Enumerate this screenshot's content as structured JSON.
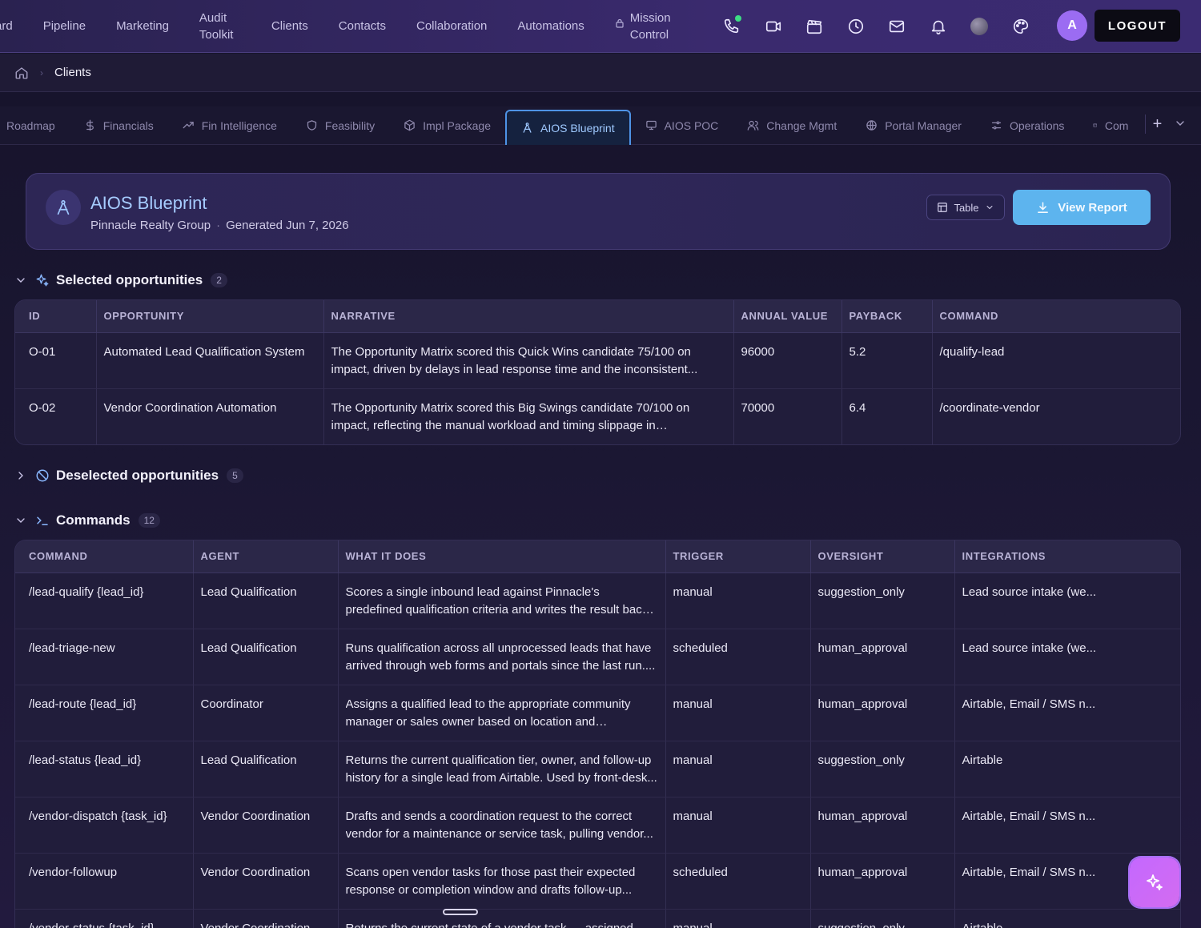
{
  "nav": {
    "links": [
      "ard",
      "Pipeline",
      "Marketing",
      "Audit Toolkit",
      "Clients",
      "Contacts",
      "Collaboration",
      "Automations",
      "Mission Control"
    ],
    "avatar_initial": "A",
    "logout_label": "LOGOUT"
  },
  "breadcrumb": {
    "current": "Clients"
  },
  "tabs": [
    {
      "label": "Roadmap",
      "icon": "map-icon"
    },
    {
      "label": "Financials",
      "icon": "dollar-icon"
    },
    {
      "label": "Fin Intelligence",
      "icon": "trend-icon"
    },
    {
      "label": "Feasibility",
      "icon": "shield-icon"
    },
    {
      "label": "Impl Package",
      "icon": "package-icon"
    },
    {
      "label": "AIOS Blueprint",
      "icon": "compass-icon",
      "active": true
    },
    {
      "label": "AIOS POC",
      "icon": "monitor-icon"
    },
    {
      "label": "Change Mgmt",
      "icon": "users-icon"
    },
    {
      "label": "Portal Manager",
      "icon": "globe-icon"
    },
    {
      "label": "Operations",
      "icon": "sliders-icon"
    },
    {
      "label": "Com",
      "icon": "layout-icon"
    }
  ],
  "header": {
    "title": "AIOS Blueprint",
    "client": "Pinnacle Realty Group",
    "generated": "Generated Jun 7, 2026",
    "view_toggle": "Table",
    "report_label": "View Report"
  },
  "selected": {
    "title": "Selected opportunities",
    "count": "2",
    "columns": [
      "ID",
      "OPPORTUNITY",
      "NARRATIVE",
      "ANNUAL VALUE",
      "PAYBACK",
      "COMMAND"
    ],
    "rows": [
      [
        "O-01",
        "Automated Lead Qualification System",
        "The Opportunity Matrix scored this Quick Wins candidate 75/100 on impact, driven by delays in lead response time and the inconsistent...",
        "96000",
        "5.2",
        "/qualify-lead"
      ],
      [
        "O-02",
        "Vendor Coordination Automation",
        "The Opportunity Matrix scored this Big Swings candidate 70/100 on impact, reflecting the manual workload and timing slippage in coordinatin...",
        "70000",
        "6.4",
        "/coordinate-vendor"
      ]
    ]
  },
  "deselected": {
    "title": "Deselected opportunities",
    "count": "5"
  },
  "commands": {
    "title": "Commands",
    "count": "12",
    "columns": [
      "COMMAND",
      "AGENT",
      "WHAT IT DOES",
      "TRIGGER",
      "OVERSIGHT",
      "INTEGRATIONS"
    ],
    "rows": [
      [
        "/lead-qualify {lead_id}",
        "Lead Qualification",
        "Scores a single inbound lead against Pinnacle's predefined qualification criteria and writes the result back to Airtable....",
        "manual",
        "suggestion_only",
        "Lead source intake (we..."
      ],
      [
        "/lead-triage-new",
        "Lead Qualification",
        "Runs qualification across all unprocessed leads that have arrived through web forms and portals since the last run....",
        "scheduled",
        "human_approval",
        "Lead source intake (we..."
      ],
      [
        "/lead-route {lead_id}",
        "Coordinator",
        "Assigns a qualified lead to the appropriate community manager or sales owner based on location and workload,...",
        "manual",
        "human_approval",
        "Airtable, Email / SMS n..."
      ],
      [
        "/lead-status {lead_id}",
        "Lead Qualification",
        "Returns the current qualification tier, owner, and follow-up history for a single lead from Airtable. Used by front-desk...",
        "manual",
        "suggestion_only",
        "Airtable"
      ],
      [
        "/vendor-dispatch {task_id}",
        "Vendor Coordination",
        "Drafts and sends a coordination request to the correct vendor for a maintenance or service task, pulling vendor...",
        "manual",
        "human_approval",
        "Airtable, Email / SMS n..."
      ],
      [
        "/vendor-followup",
        "Vendor Coordination",
        "Scans open vendor tasks for those past their expected response or completion window and drafts follow-up...",
        "scheduled",
        "human_approval",
        "Airtable, Email / SMS n..."
      ],
      [
        "/vendor-status {task_id}",
        "Vendor Coordination",
        "Returns the current state of a vendor task — assigned...",
        "manual",
        "suggestion_only",
        "Airtable"
      ]
    ]
  },
  "colors": {
    "accent": "#5db4ee",
    "active_tab": "#4e93e6",
    "fab": "#c468ff"
  }
}
